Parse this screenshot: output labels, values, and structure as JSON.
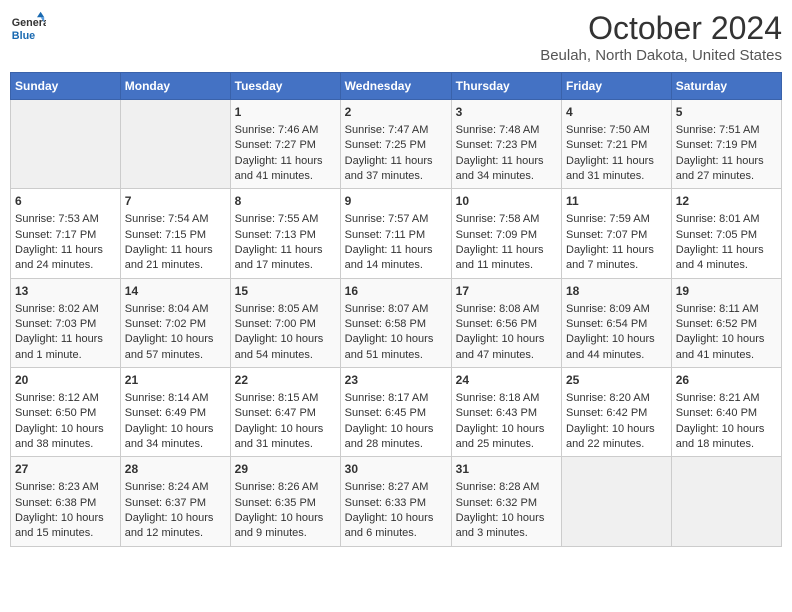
{
  "logo": {
    "line1": "General",
    "line2": "Blue"
  },
  "title": "October 2024",
  "subtitle": "Beulah, North Dakota, United States",
  "days_of_week": [
    "Sunday",
    "Monday",
    "Tuesday",
    "Wednesday",
    "Thursday",
    "Friday",
    "Saturday"
  ],
  "weeks": [
    [
      {
        "day": "",
        "sunrise": "",
        "sunset": "",
        "daylight": ""
      },
      {
        "day": "",
        "sunrise": "",
        "sunset": "",
        "daylight": ""
      },
      {
        "day": "1",
        "sunrise": "Sunrise: 7:46 AM",
        "sunset": "Sunset: 7:27 PM",
        "daylight": "Daylight: 11 hours and 41 minutes."
      },
      {
        "day": "2",
        "sunrise": "Sunrise: 7:47 AM",
        "sunset": "Sunset: 7:25 PM",
        "daylight": "Daylight: 11 hours and 37 minutes."
      },
      {
        "day": "3",
        "sunrise": "Sunrise: 7:48 AM",
        "sunset": "Sunset: 7:23 PM",
        "daylight": "Daylight: 11 hours and 34 minutes."
      },
      {
        "day": "4",
        "sunrise": "Sunrise: 7:50 AM",
        "sunset": "Sunset: 7:21 PM",
        "daylight": "Daylight: 11 hours and 31 minutes."
      },
      {
        "day": "5",
        "sunrise": "Sunrise: 7:51 AM",
        "sunset": "Sunset: 7:19 PM",
        "daylight": "Daylight: 11 hours and 27 minutes."
      }
    ],
    [
      {
        "day": "6",
        "sunrise": "Sunrise: 7:53 AM",
        "sunset": "Sunset: 7:17 PM",
        "daylight": "Daylight: 11 hours and 24 minutes."
      },
      {
        "day": "7",
        "sunrise": "Sunrise: 7:54 AM",
        "sunset": "Sunset: 7:15 PM",
        "daylight": "Daylight: 11 hours and 21 minutes."
      },
      {
        "day": "8",
        "sunrise": "Sunrise: 7:55 AM",
        "sunset": "Sunset: 7:13 PM",
        "daylight": "Daylight: 11 hours and 17 minutes."
      },
      {
        "day": "9",
        "sunrise": "Sunrise: 7:57 AM",
        "sunset": "Sunset: 7:11 PM",
        "daylight": "Daylight: 11 hours and 14 minutes."
      },
      {
        "day": "10",
        "sunrise": "Sunrise: 7:58 AM",
        "sunset": "Sunset: 7:09 PM",
        "daylight": "Daylight: 11 hours and 11 minutes."
      },
      {
        "day": "11",
        "sunrise": "Sunrise: 7:59 AM",
        "sunset": "Sunset: 7:07 PM",
        "daylight": "Daylight: 11 hours and 7 minutes."
      },
      {
        "day": "12",
        "sunrise": "Sunrise: 8:01 AM",
        "sunset": "Sunset: 7:05 PM",
        "daylight": "Daylight: 11 hours and 4 minutes."
      }
    ],
    [
      {
        "day": "13",
        "sunrise": "Sunrise: 8:02 AM",
        "sunset": "Sunset: 7:03 PM",
        "daylight": "Daylight: 11 hours and 1 minute."
      },
      {
        "day": "14",
        "sunrise": "Sunrise: 8:04 AM",
        "sunset": "Sunset: 7:02 PM",
        "daylight": "Daylight: 10 hours and 57 minutes."
      },
      {
        "day": "15",
        "sunrise": "Sunrise: 8:05 AM",
        "sunset": "Sunset: 7:00 PM",
        "daylight": "Daylight: 10 hours and 54 minutes."
      },
      {
        "day": "16",
        "sunrise": "Sunrise: 8:07 AM",
        "sunset": "Sunset: 6:58 PM",
        "daylight": "Daylight: 10 hours and 51 minutes."
      },
      {
        "day": "17",
        "sunrise": "Sunrise: 8:08 AM",
        "sunset": "Sunset: 6:56 PM",
        "daylight": "Daylight: 10 hours and 47 minutes."
      },
      {
        "day": "18",
        "sunrise": "Sunrise: 8:09 AM",
        "sunset": "Sunset: 6:54 PM",
        "daylight": "Daylight: 10 hours and 44 minutes."
      },
      {
        "day": "19",
        "sunrise": "Sunrise: 8:11 AM",
        "sunset": "Sunset: 6:52 PM",
        "daylight": "Daylight: 10 hours and 41 minutes."
      }
    ],
    [
      {
        "day": "20",
        "sunrise": "Sunrise: 8:12 AM",
        "sunset": "Sunset: 6:50 PM",
        "daylight": "Daylight: 10 hours and 38 minutes."
      },
      {
        "day": "21",
        "sunrise": "Sunrise: 8:14 AM",
        "sunset": "Sunset: 6:49 PM",
        "daylight": "Daylight: 10 hours and 34 minutes."
      },
      {
        "day": "22",
        "sunrise": "Sunrise: 8:15 AM",
        "sunset": "Sunset: 6:47 PM",
        "daylight": "Daylight: 10 hours and 31 minutes."
      },
      {
        "day": "23",
        "sunrise": "Sunrise: 8:17 AM",
        "sunset": "Sunset: 6:45 PM",
        "daylight": "Daylight: 10 hours and 28 minutes."
      },
      {
        "day": "24",
        "sunrise": "Sunrise: 8:18 AM",
        "sunset": "Sunset: 6:43 PM",
        "daylight": "Daylight: 10 hours and 25 minutes."
      },
      {
        "day": "25",
        "sunrise": "Sunrise: 8:20 AM",
        "sunset": "Sunset: 6:42 PM",
        "daylight": "Daylight: 10 hours and 22 minutes."
      },
      {
        "day": "26",
        "sunrise": "Sunrise: 8:21 AM",
        "sunset": "Sunset: 6:40 PM",
        "daylight": "Daylight: 10 hours and 18 minutes."
      }
    ],
    [
      {
        "day": "27",
        "sunrise": "Sunrise: 8:23 AM",
        "sunset": "Sunset: 6:38 PM",
        "daylight": "Daylight: 10 hours and 15 minutes."
      },
      {
        "day": "28",
        "sunrise": "Sunrise: 8:24 AM",
        "sunset": "Sunset: 6:37 PM",
        "daylight": "Daylight: 10 hours and 12 minutes."
      },
      {
        "day": "29",
        "sunrise": "Sunrise: 8:26 AM",
        "sunset": "Sunset: 6:35 PM",
        "daylight": "Daylight: 10 hours and 9 minutes."
      },
      {
        "day": "30",
        "sunrise": "Sunrise: 8:27 AM",
        "sunset": "Sunset: 6:33 PM",
        "daylight": "Daylight: 10 hours and 6 minutes."
      },
      {
        "day": "31",
        "sunrise": "Sunrise: 8:28 AM",
        "sunset": "Sunset: 6:32 PM",
        "daylight": "Daylight: 10 hours and 3 minutes."
      },
      {
        "day": "",
        "sunrise": "",
        "sunset": "",
        "daylight": ""
      },
      {
        "day": "",
        "sunrise": "",
        "sunset": "",
        "daylight": ""
      }
    ]
  ]
}
